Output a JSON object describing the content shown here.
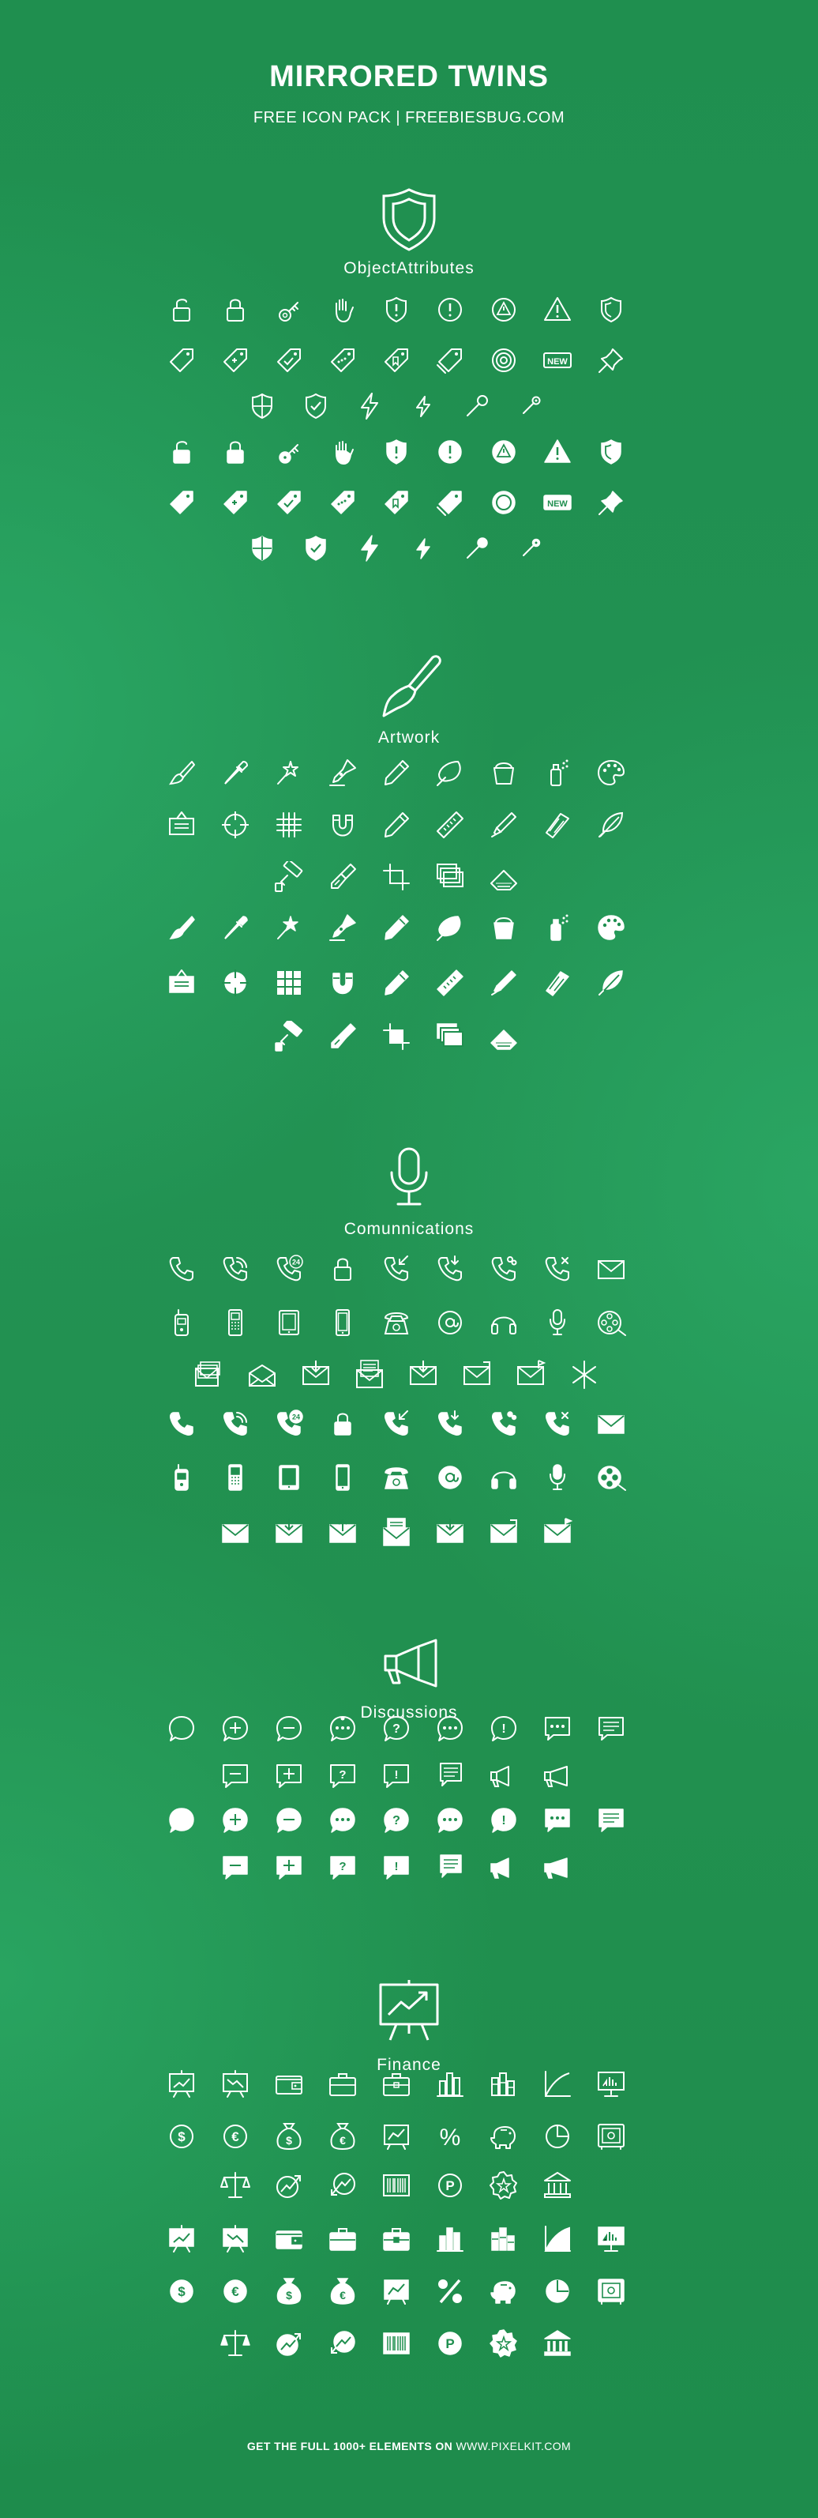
{
  "header": {
    "title": "MIRRORED TWINS",
    "subtitle": "FREE ICON PACK  |  FREEBIESBUG.COM"
  },
  "footer": {
    "text": "GET THE FULL 1000+ ELEMENTS ON",
    "site": "WWW.PIXELKIT.COM"
  },
  "sections": [
    {
      "title": "ObjectAttributes",
      "header_icon": "shield-icon",
      "outline_rows": [
        [
          "unlock-icon",
          "lock-icon",
          "key-icon",
          "hand-icon",
          "shield-alert-icon",
          "circle-alert-icon",
          "triangle-circle-alert-icon",
          "triangle-alert-icon",
          "shield-icon"
        ],
        [
          "tag-icon",
          "tag-plus-icon",
          "tag-check-icon",
          "tag-dots-icon",
          "tag-bookmark-icon",
          "tag-double-icon",
          "target-icon",
          "new-badge-icon",
          "pushpin-icon"
        ],
        [
          "shield-half-icon",
          "shield-check-icon",
          "bolt-icon",
          "bolt-small-icon",
          "pin-icon",
          "pin-small-icon"
        ]
      ],
      "filled_rows": [
        [
          "unlock-icon",
          "lock-icon",
          "key-icon",
          "hand-icon",
          "shield-alert-icon",
          "circle-alert-icon",
          "triangle-circle-alert-icon",
          "triangle-alert-icon",
          "shield-icon"
        ],
        [
          "tag-icon",
          "tag-plus-icon",
          "tag-check-icon",
          "tag-dots-icon",
          "tag-bookmark-icon",
          "tag-double-icon",
          "target-icon",
          "new-badge-icon",
          "pushpin-icon"
        ],
        [
          "shield-half-icon",
          "shield-check-icon",
          "bolt-icon",
          "bolt-small-icon",
          "pin-icon",
          "pin-small-icon"
        ]
      ],
      "new_label": "NEW"
    },
    {
      "title": "Artwork",
      "header_icon": "paintbrush-icon",
      "outline_rows": [
        [
          "brush-icon",
          "pipette-icon",
          "magic-wand-icon",
          "pen-nib-icon",
          "pencil-icon",
          "leaf-brush-icon",
          "bucket-icon",
          "spray-icon",
          "palette-icon"
        ],
        [
          "easel-icon",
          "crosshair-icon",
          "grid-icon",
          "magnet-icon",
          "pencil-alt-icon",
          "ruler-icon",
          "marker-icon",
          "swatches-icon",
          "feather-icon"
        ],
        [
          "roller-icon",
          "wide-brush-icon",
          "crop-icon",
          "layers-icon",
          "set-square-icon"
        ]
      ],
      "filled_rows": [
        [
          "brush-icon",
          "pipette-icon",
          "magic-wand-icon",
          "pen-nib-icon",
          "pencil-icon",
          "leaf-brush-icon",
          "bucket-icon",
          "spray-icon",
          "palette-icon"
        ],
        [
          "easel-icon",
          "crosshair-icon",
          "grid-icon",
          "magnet-icon",
          "pencil-alt-icon",
          "ruler-icon",
          "marker-icon",
          "swatches-icon",
          "feather-icon"
        ],
        [
          "roller-icon",
          "wide-brush-icon",
          "crop-icon",
          "layers-icon",
          "set-square-icon"
        ]
      ]
    },
    {
      "title": "Comunnications",
      "header_icon": "microphone-icon",
      "outline_rows": [
        [
          "phone-icon",
          "phone-signal-icon",
          "phone-24-icon",
          "phone-clock-icon",
          "phone-incoming-icon",
          "phone-outgoing-icon",
          "phone-group-icon",
          "phone-missed-icon",
          "mail-icon"
        ],
        [
          "old-cellphone-icon",
          "cellphone-icon",
          "tablet-icon",
          "smartphone-icon",
          "desk-phone-icon",
          "at-sign-icon",
          "headphones-icon",
          "microphone-small-icon",
          "film-reel-icon"
        ],
        [
          "mail-stack-icon",
          "mail-open-icon",
          "mail-download-icon",
          "mail-letter-icon",
          "mail-receive-icon",
          "mail-send-icon",
          "mail-flag-icon",
          "spark-icon"
        ]
      ],
      "filled_rows": [
        [
          "phone-icon",
          "phone-signal-icon",
          "phone-24-icon",
          "phone-clock-icon",
          "phone-incoming-icon",
          "phone-outgoing-icon",
          "phone-group-icon",
          "phone-missed-icon",
          "mail-icon"
        ],
        [
          "old-cellphone-icon",
          "cellphone-icon",
          "tablet-icon",
          "smartphone-icon",
          "desk-phone-icon",
          "at-sign-icon",
          "headphones-icon",
          "microphone-small-icon",
          "film-reel-icon"
        ],
        [
          "mail-closed-icon",
          "mail-download-icon",
          "mail-upload-icon",
          "mail-letter-icon",
          "mail-receive-icon",
          "mail-send-icon",
          "mail-flag-icon"
        ]
      ],
      "badge_24": "24"
    },
    {
      "title": "Discussions",
      "header_icon": "megaphone-icon",
      "outline_rows": [
        [
          "speech-bubble-icon",
          "bubble-plus-icon",
          "bubble-minus-icon",
          "bubble-dots-icon",
          "bubble-question-icon",
          "bubble-ellipsis-icon",
          "bubble-alert-icon",
          "square-bubble-dots-icon",
          "square-bubble-lines-icon"
        ],
        [
          "square-bubble-minus-icon",
          "square-bubble-plus-icon",
          "square-bubble-question-icon",
          "square-bubble-alert-icon",
          "square-bubble-text-icon",
          "megaphone-small-icon",
          "megaphone-icon"
        ]
      ],
      "filled_rows": [
        [
          "speech-bubble-icon",
          "bubble-plus-icon",
          "bubble-minus-icon",
          "bubble-dots-icon",
          "bubble-question-icon",
          "bubble-ellipsis-icon",
          "bubble-alert-icon",
          "square-bubble-dots-icon",
          "square-bubble-lines-icon"
        ],
        [
          "square-bubble-minus-icon",
          "square-bubble-plus-icon",
          "square-bubble-question-icon",
          "square-bubble-alert-icon",
          "square-bubble-text-icon",
          "megaphone-small-icon",
          "megaphone-icon"
        ]
      ]
    },
    {
      "title": "Finance",
      "header_icon": "presentation-chart-icon",
      "outline_rows": [
        [
          "presentation-up-icon",
          "presentation-down-icon",
          "wallet-icon",
          "briefcase-icon",
          "suitcase-icon",
          "bar-chart-icon",
          "bar-chart-alt-icon",
          "curve-chart-icon",
          "monitor-chart-icon"
        ],
        [
          "dollar-coin-icon",
          "euro-coin-icon",
          "dollar-bag-icon",
          "euro-bag-icon",
          "growth-board-icon",
          "percent-icon",
          "piggy-bank-icon",
          "pie-chart-icon",
          "safe-icon"
        ],
        [
          "scales-icon",
          "trend-up-icon",
          "trend-down-icon",
          "barcode-icon",
          "coin-p-icon",
          "star-badge-icon",
          "bank-icon"
        ]
      ],
      "filled_rows": [
        [
          "presentation-up-icon",
          "presentation-down-icon",
          "wallet-icon",
          "briefcase-icon",
          "suitcase-icon",
          "bar-chart-icon",
          "bar-chart-alt-icon",
          "curve-chart-icon",
          "monitor-chart-icon"
        ],
        [
          "dollar-coin-icon",
          "euro-coin-icon",
          "dollar-bag-icon",
          "euro-bag-icon",
          "growth-board-icon",
          "percent-icon",
          "piggy-bank-icon",
          "pie-chart-icon",
          "safe-icon"
        ],
        [
          "scales-icon",
          "trend-up-icon",
          "trend-down-icon",
          "barcode-icon",
          "coin-p-icon",
          "star-badge-icon",
          "bank-icon"
        ]
      ],
      "dollar": "$",
      "euro": "€",
      "percent": "%",
      "p_letter": "P"
    }
  ]
}
